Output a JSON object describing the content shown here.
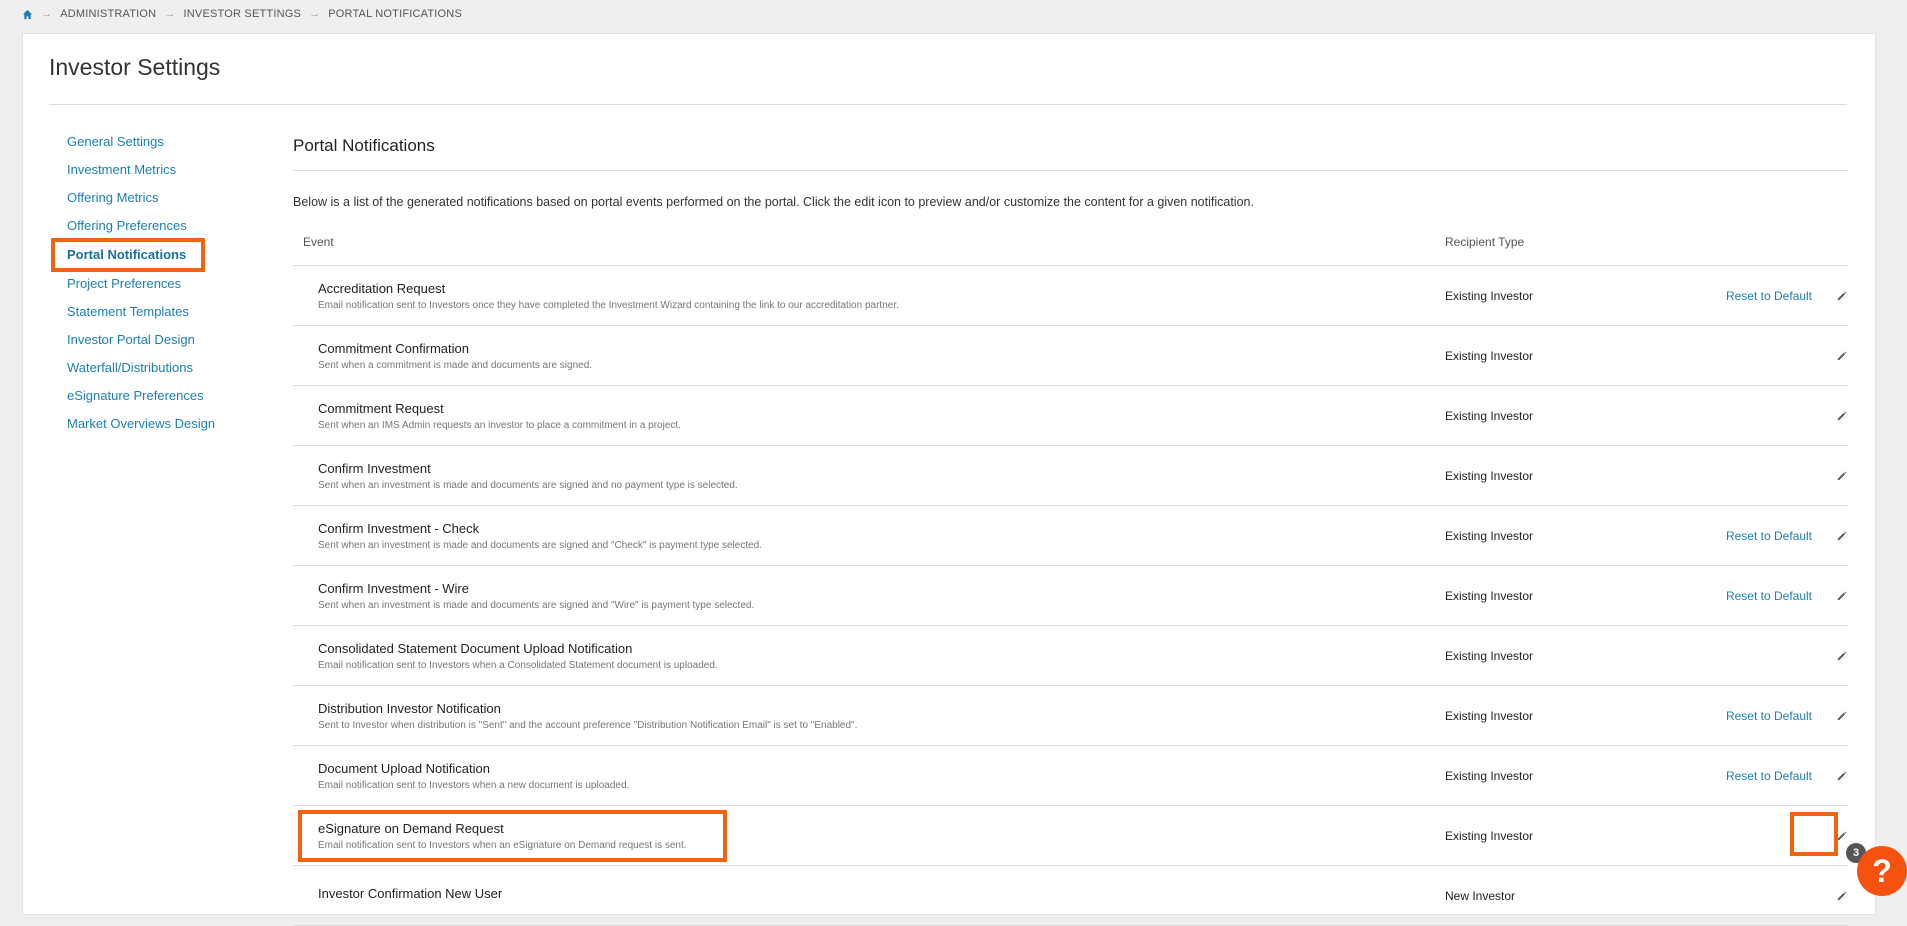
{
  "breadcrumb": {
    "items": [
      "ADMINISTRATION",
      "INVESTOR SETTINGS",
      "PORTAL NOTIFICATIONS"
    ]
  },
  "page": {
    "title": "Investor Settings"
  },
  "sidebar": {
    "items": [
      {
        "label": "General Settings"
      },
      {
        "label": "Investment Metrics"
      },
      {
        "label": "Offering Metrics"
      },
      {
        "label": "Offering Preferences"
      },
      {
        "label": "Portal Notifications",
        "active": true
      },
      {
        "label": "Project Preferences"
      },
      {
        "label": "Statement Templates"
      },
      {
        "label": "Investor Portal Design"
      },
      {
        "label": "Waterfall/Distributions"
      },
      {
        "label": "eSignature Preferences"
      },
      {
        "label": "Market Overviews Design"
      }
    ]
  },
  "section": {
    "title": "Portal Notifications",
    "intro": "Below is a list of the generated notifications based on portal events performed on the portal. Click the edit icon to preview and/or customize the content for a given notification."
  },
  "table": {
    "headers": {
      "event": "Event",
      "recipient": "Recipient Type"
    },
    "reset_label": "Reset to Default",
    "rows": [
      {
        "title": "Accreditation Request",
        "desc": "Email notification sent to Investors once they have completed the Investment Wizard containing the link to our accreditation partner.",
        "recipient": "Existing Investor",
        "reset": true
      },
      {
        "title": "Commitment Confirmation",
        "desc": "Sent when a commitment is made and documents are signed.",
        "recipient": "Existing Investor",
        "reset": false
      },
      {
        "title": "Commitment Request",
        "desc": "Sent when an IMS Admin requests an investor to place a commitment in a project.",
        "recipient": "Existing Investor",
        "reset": false
      },
      {
        "title": "Confirm Investment",
        "desc": "Sent when an investment is made and documents are signed and no payment type is selected.",
        "recipient": "Existing Investor",
        "reset": false
      },
      {
        "title": "Confirm Investment - Check",
        "desc": "Sent when an investment is made and documents are signed and \"Check\" is payment type selected.",
        "recipient": "Existing Investor",
        "reset": true
      },
      {
        "title": "Confirm Investment - Wire",
        "desc": "Sent when an investment is made and documents are signed and \"Wire\" is payment type selected.",
        "recipient": "Existing Investor",
        "reset": true
      },
      {
        "title": "Consolidated Statement Document Upload Notification",
        "desc": "Email notification sent to Investors when a Consolidated Statement document is uploaded.",
        "recipient": "Existing Investor",
        "reset": false
      },
      {
        "title": "Distribution Investor Notification",
        "desc": "Sent to Investor when distribution is \"Sent\" and the account preference \"Distribution Notification Email\" is set to \"Enabled\".",
        "recipient": "Existing Investor",
        "reset": true
      },
      {
        "title": "Document Upload Notification",
        "desc": "Email notification sent to Investors when a new document is uploaded.",
        "recipient": "Existing Investor",
        "reset": true
      },
      {
        "title": "eSignature on Demand Request",
        "desc": "Email notification sent to Investors when an eSignature on Demand request is sent.",
        "recipient": "Existing Investor",
        "reset": false,
        "highlight": true
      },
      {
        "title": "Investor Confirmation New User",
        "desc": "",
        "recipient": "New Investor",
        "reset": false
      }
    ]
  },
  "help": {
    "label": "?",
    "badge": "3"
  },
  "colors": {
    "accent": "#1a7fb5",
    "highlight": "#f5620f",
    "help": "#f5520f"
  },
  "icons": {
    "home": "home-icon",
    "edit": "pencil-icon",
    "help": "help-icon"
  }
}
